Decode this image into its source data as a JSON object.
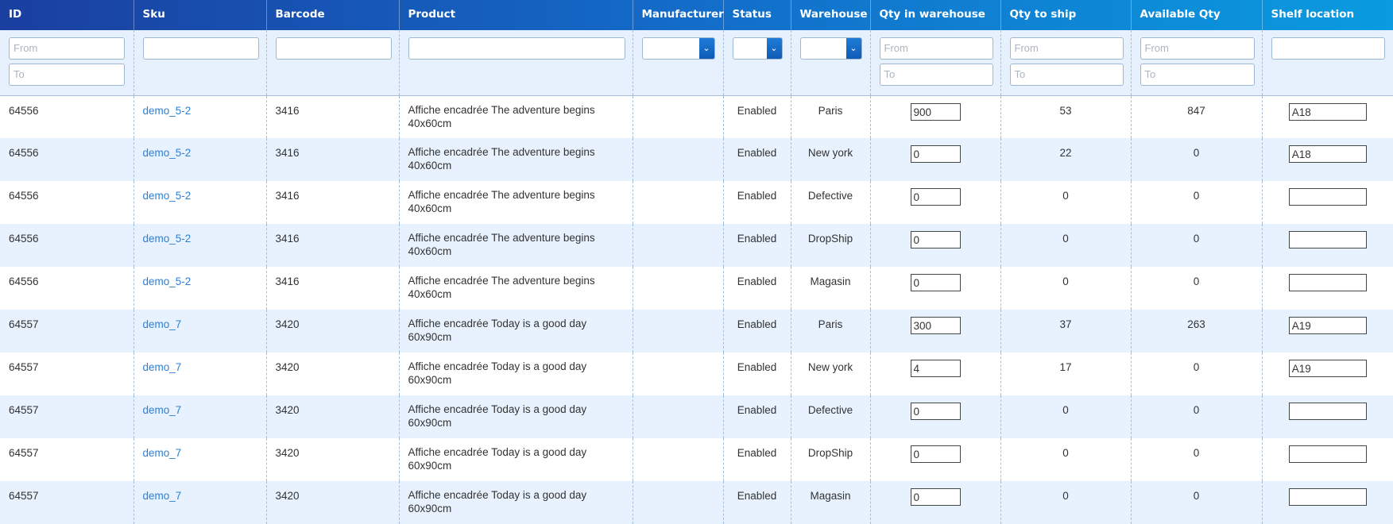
{
  "columns": [
    "ID",
    "Sku",
    "Barcode",
    "Product",
    "Manufacturer",
    "Status",
    "Warehouse",
    "Qty in warehouse",
    "Qty to ship",
    "Available Qty",
    "Shelf location"
  ],
  "filters": {
    "from_placeholder": "From",
    "to_placeholder": "To"
  },
  "rows": [
    {
      "id": "64556",
      "sku": "demo_5-2",
      "barcode": "3416",
      "product": "Affiche encadrée The adventure begins 40x60cm",
      "manufacturer": "",
      "status": "Enabled",
      "warehouse": "Paris",
      "qty_wh": "900",
      "qty_ship": "53",
      "available": "847",
      "shelf": "A18"
    },
    {
      "id": "64556",
      "sku": "demo_5-2",
      "barcode": "3416",
      "product": "Affiche encadrée The adventure begins 40x60cm",
      "manufacturer": "",
      "status": "Enabled",
      "warehouse": "New york",
      "qty_wh": "0",
      "qty_ship": "22",
      "available": "0",
      "shelf": "A18"
    },
    {
      "id": "64556",
      "sku": "demo_5-2",
      "barcode": "3416",
      "product": "Affiche encadrée The adventure begins 40x60cm",
      "manufacturer": "",
      "status": "Enabled",
      "warehouse": "Defective",
      "qty_wh": "0",
      "qty_ship": "0",
      "available": "0",
      "shelf": ""
    },
    {
      "id": "64556",
      "sku": "demo_5-2",
      "barcode": "3416",
      "product": "Affiche encadrée The adventure begins 40x60cm",
      "manufacturer": "",
      "status": "Enabled",
      "warehouse": "DropShip",
      "qty_wh": "0",
      "qty_ship": "0",
      "available": "0",
      "shelf": ""
    },
    {
      "id": "64556",
      "sku": "demo_5-2",
      "barcode": "3416",
      "product": "Affiche encadrée The adventure begins 40x60cm",
      "manufacturer": "",
      "status": "Enabled",
      "warehouse": "Magasin",
      "qty_wh": "0",
      "qty_ship": "0",
      "available": "0",
      "shelf": ""
    },
    {
      "id": "64557",
      "sku": "demo_7",
      "barcode": "3420",
      "product": "Affiche encadrée Today is a good day 60x90cm",
      "manufacturer": "",
      "status": "Enabled",
      "warehouse": "Paris",
      "qty_wh": "300",
      "qty_ship": "37",
      "available": "263",
      "shelf": "A19"
    },
    {
      "id": "64557",
      "sku": "demo_7",
      "barcode": "3420",
      "product": "Affiche encadrée Today is a good day 60x90cm",
      "manufacturer": "",
      "status": "Enabled",
      "warehouse": "New york",
      "qty_wh": "4",
      "qty_ship": "17",
      "available": "0",
      "shelf": "A19"
    },
    {
      "id": "64557",
      "sku": "demo_7",
      "barcode": "3420",
      "product": "Affiche encadrée Today is a good day 60x90cm",
      "manufacturer": "",
      "status": "Enabled",
      "warehouse": "Defective",
      "qty_wh": "0",
      "qty_ship": "0",
      "available": "0",
      "shelf": ""
    },
    {
      "id": "64557",
      "sku": "demo_7",
      "barcode": "3420",
      "product": "Affiche encadrée Today is a good day 60x90cm",
      "manufacturer": "",
      "status": "Enabled",
      "warehouse": "DropShip",
      "qty_wh": "0",
      "qty_ship": "0",
      "available": "0",
      "shelf": ""
    },
    {
      "id": "64557",
      "sku": "demo_7",
      "barcode": "3420",
      "product": "Affiche encadrée Today is a good day 60x90cm",
      "manufacturer": "",
      "status": "Enabled",
      "warehouse": "Magasin",
      "qty_wh": "0",
      "qty_ship": "0",
      "available": "0",
      "shelf": ""
    }
  ],
  "icons": {
    "dropdown": "chevron-down-icon"
  },
  "colors": {
    "header_start": "#1a3fa0",
    "header_end": "#0a9be0",
    "row_alt": "#e7f2fe",
    "filter_bg": "#e6f1fd",
    "link": "#2f7fd0"
  }
}
